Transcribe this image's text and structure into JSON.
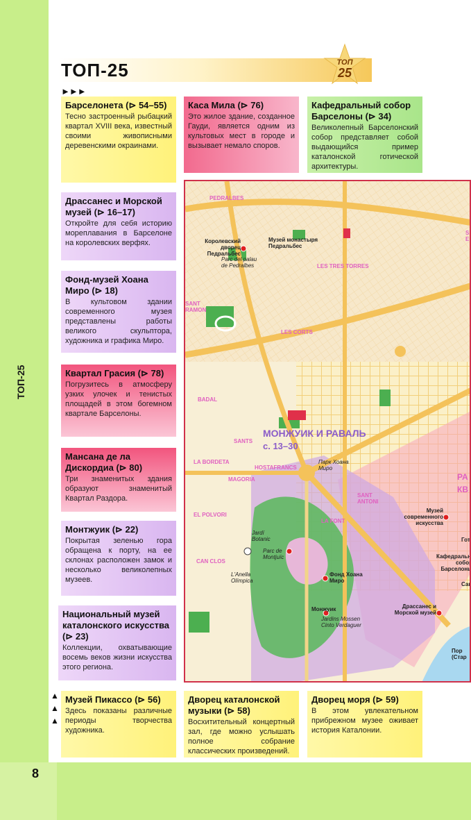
{
  "page": {
    "title": "ТОП-25",
    "side_label": "ТОП-25",
    "page_number": "8",
    "arrows": "►►►",
    "badge": {
      "line1": "ТОП",
      "line2": "25"
    }
  },
  "cards": [
    {
      "title": "Барселонета (⊳ 54–55)",
      "desc": "Тесно застроенный рыбацкий квартал XVIII века, известный своими живописными деревенскими окраинами."
    },
    {
      "title": "Каса Мила (⊳ 76)",
      "desc": "Это жилое здание, созданное Гауди, является одним из культовых мест в городе и вызывает немало споров."
    },
    {
      "title": "Кафедральный собор Барселоны (⊳ 34)",
      "desc": "Великолепный Барселонский собор представляет собой выдающийся пример каталонской готической архитектуры."
    },
    {
      "title": "Драссанес и Морской музей (⊳ 16–17)",
      "desc": "Откройте для себя историю мореплавания в Барселоне на королевских верфях."
    },
    {
      "title": "Фонд-музей Хоана Миро (⊳ 18)",
      "desc": "В культовом здании современного музея представлены работы великого скульптора, художника и графика Миро."
    },
    {
      "title": "Квартал Грасия (⊳ 78)",
      "desc": "Погрузитесь в атмосферу узких улочек и тенистых площадей в этом богемном квартале Барселоны."
    },
    {
      "title": "Мансана де ла Дискордиа (⊳ 80)",
      "desc": "Три знаменитых здания образуют знаменитый Квартал Раздора."
    },
    {
      "title": "Монтжуик (⊳ 22)",
      "desc": "Покрытая зеленью гора обращена к порту, на ее склонах расположен замок и несколько великолепных музеев."
    },
    {
      "title": "Национальный музей каталонского искусства (⊳ 23)",
      "desc": "Коллекции, охватывающие восемь веков жизни искусства этого региона."
    },
    {
      "title": "Музей Пикассо (⊳ 56)",
      "desc": "Здесь показаны различные периоды творчества художника."
    },
    {
      "title": "Дворец каталонской музыки (⊳ 58)",
      "desc": "Восхитительный концертный зал, где можно услышать полное собрание классических произведений."
    },
    {
      "title": "Дворец моря (⊳ 59)",
      "desc": "В этом увлекательном прибрежном музее оживает история Каталонии."
    }
  ],
  "map": {
    "labels": {
      "pedralbes": "PEDRALBES",
      "palace_ru": "Королевский дворец Педральбес",
      "palace_it": "Parc del palau de Pedralbes",
      "monastery": "Музей монастыря Педральбес",
      "tres_torres": "LES TRES TORRES",
      "les_corts": "LES CORTS",
      "sant_ramon": "SANT RAMON",
      "badal": "BADAL",
      "sants": "SANTS",
      "la_bordeta": "LA BORDETA",
      "hostafrancs": "HOSTAFRANCS",
      "magoria": "MAGORIA",
      "el_polvori": "EL POLVORI",
      "can_clos": "CAN CLOS",
      "sant_antoni": "SANT ANTONI",
      "la_font": "LA FONT",
      "montjuic_raval": "МОНЖУИК И РАВАЛЬ",
      "pages": "с. 13–30",
      "park_miro": "Парк Хоана Миро",
      "jardi_botanic": "Jardí Botanic",
      "parc_montjuic": "Parc de Montjuïc",
      "anella": "L'Anella Olímpica",
      "fond_miro": "Фонд Хоана Миро",
      "montjuic": "Монжуик",
      "jardins": "Jardins Mossen Cinto Verdaguer",
      "drassanes": "Драссанес и Морской музей",
      "macba": "Музей современного искусства",
      "cathedral": "Кафедральный собор Барселоны",
      "got": "Гот",
      "kv": "КВ",
      "ra": "РА",
      "port": "Пор (Стар",
      "san": "Сан",
      "s_top": "S E",
      "ont": "ONT"
    },
    "colors": {
      "street_major": "#f4c25a",
      "street_minor": "#f2d488",
      "park": "#4caf50",
      "overlay_purple": "#c9a6e0",
      "overlay_pink": "#f7a6c0",
      "water": "#a9d8f0"
    }
  }
}
